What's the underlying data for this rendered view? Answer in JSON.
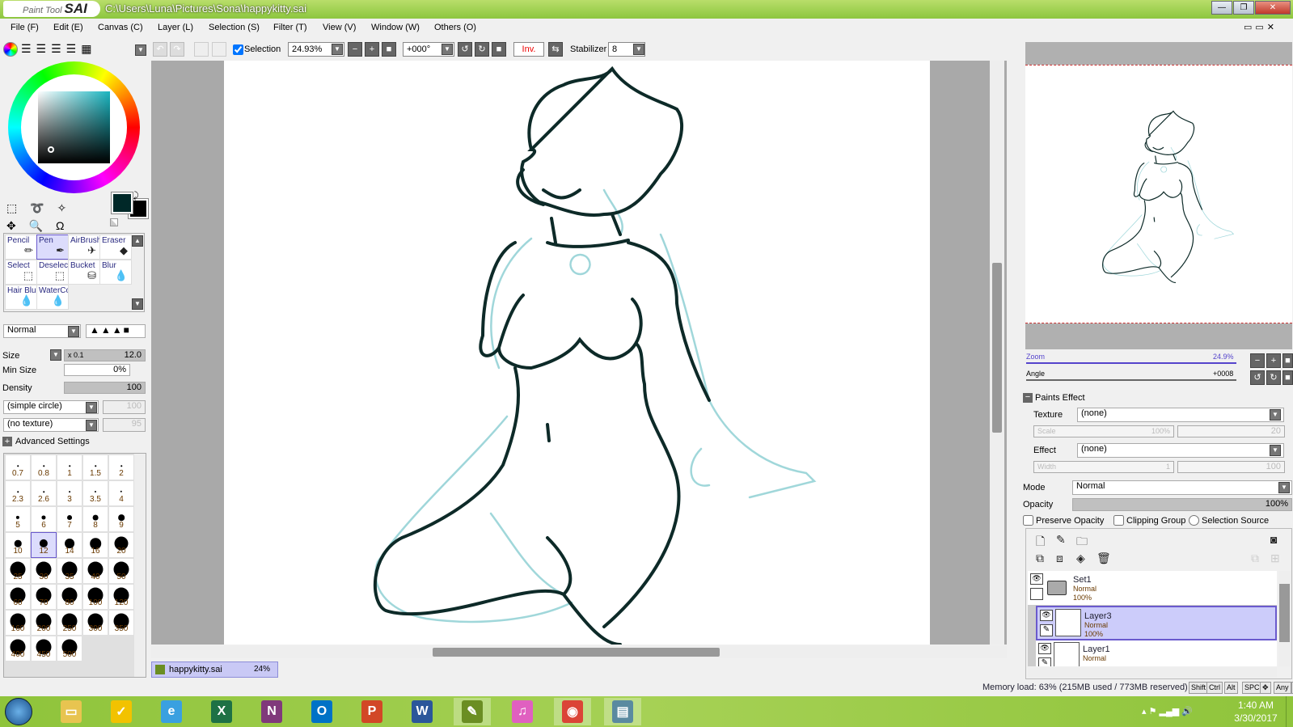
{
  "app": {
    "logo_text": "Paint Tool SAI",
    "title_path": "C:\\Users\\Luna\\Pictures\\Sona\\happykitty.sai"
  },
  "menu": [
    "File (F)",
    "Edit (E)",
    "Canvas (C)",
    "Layer (L)",
    "Selection (S)",
    "Filter (T)",
    "View (V)",
    "Window (W)",
    "Others (O)"
  ],
  "toolbar": {
    "selection_label": "Selection",
    "selection_checked": true,
    "zoom_value": "24.93%",
    "angle_value": "+000°",
    "invert_label": "Inv.",
    "stabilizer_label": "Stabilizer",
    "stabilizer_value": "8"
  },
  "colors": {
    "primary": "#002828",
    "secondary": "#000000",
    "accent": "#6a5acd",
    "titlebar": "#8cc63f",
    "sketch_line": "#0d2a28",
    "sketch_blue": "#8fd0d4"
  },
  "tools": [
    {
      "label": "Pencil",
      "icon": "pencil-icon"
    },
    {
      "label": "Pen",
      "icon": "pen-icon",
      "selected": true
    },
    {
      "label": "AirBrush",
      "icon": "airbrush-icon"
    },
    {
      "label": "Eraser",
      "icon": "eraser-icon"
    },
    {
      "label": "Select",
      "icon": "select-icon"
    },
    {
      "label": "Deselect",
      "icon": "deselect-icon"
    },
    {
      "label": "Bucket",
      "icon": "bucket-icon"
    },
    {
      "label": "Blur",
      "icon": "blur-icon"
    },
    {
      "label": "Hair Blur",
      "icon": "hair-blur-icon"
    },
    {
      "label": "WaterColor",
      "icon": "watercolor-icon"
    }
  ],
  "brush": {
    "blend_mode": "Normal",
    "size_label": "Size",
    "size_multiplier": "x 0.1",
    "size_value": "12.0",
    "min_size_label": "Min Size",
    "min_size_value": "0%",
    "density_label": "Density",
    "density_value": "100",
    "shape": "(simple circle)",
    "shape_value": "100",
    "texture": "(no texture)",
    "texture_value": "95",
    "advanced_label": "Advanced Settings",
    "sizes": [
      "0.7",
      "0.8",
      "1",
      "1.5",
      "2",
      "2.3",
      "2.6",
      "3",
      "3.5",
      "4",
      "5",
      "6",
      "7",
      "8",
      "9",
      "10",
      "12",
      "14",
      "16",
      "20",
      "25",
      "30",
      "35",
      "40",
      "50",
      "60",
      "70",
      "80",
      "100",
      "120",
      "160",
      "200",
      "250",
      "300",
      "350",
      "400",
      "450",
      "500"
    ],
    "selected_size": "12"
  },
  "document_tab": {
    "name": "happykitty.sai",
    "zoom": "24%"
  },
  "navigator": {
    "zoom_label": "Zoom",
    "zoom_value": "24.9%",
    "angle_label": "Angle",
    "angle_value": "+0008"
  },
  "paints_effect": {
    "header": "Paints Effect",
    "texture_label": "Texture",
    "texture_value": "(none)",
    "scale_label": "Scale",
    "scale_value": "100%",
    "scale_value2": "20",
    "effect_label": "Effect",
    "effect_value": "(none)",
    "width_label": "Width",
    "width_value": "1",
    "width_value2": "100"
  },
  "layer_props": {
    "mode_label": "Mode",
    "mode_value": "Normal",
    "opacity_label": "Opacity",
    "opacity_value": "100%",
    "preserve_opacity": "Preserve Opacity",
    "clipping_group": "Clipping Group",
    "selection_source": "Selection Source"
  },
  "layers": [
    {
      "name": "Set1",
      "mode": "Normal",
      "opacity": "100%",
      "type": "folder"
    },
    {
      "name": "Layer3",
      "mode": "Normal",
      "opacity": "100%",
      "type": "layer",
      "selected": true
    },
    {
      "name": "Layer1",
      "mode": "Normal",
      "opacity": "",
      "type": "layer"
    }
  ],
  "status": {
    "memory": "Memory load: 63% (215MB used / 773MB reserved)",
    "keys": [
      "Shift",
      "Ctrl",
      "Alt",
      "SPC",
      "✥",
      "Any",
      "✎"
    ]
  },
  "taskbar": {
    "apps": [
      {
        "name": "explorer",
        "color": "#e8c450",
        "glyph": "▭"
      },
      {
        "name": "norton",
        "color": "#f2c200",
        "glyph": "✓"
      },
      {
        "name": "internet-explorer",
        "color": "#3aa0e0",
        "glyph": "e"
      },
      {
        "name": "excel",
        "color": "#1e7145",
        "glyph": "X"
      },
      {
        "name": "onenote",
        "color": "#80397b",
        "glyph": "N"
      },
      {
        "name": "outlook",
        "color": "#0072c6",
        "glyph": "O"
      },
      {
        "name": "powerpoint",
        "color": "#d24726",
        "glyph": "P"
      },
      {
        "name": "word",
        "color": "#2b579a",
        "glyph": "W"
      },
      {
        "name": "paint-tool-sai",
        "color": "#6b8e23",
        "glyph": "✎"
      },
      {
        "name": "itunes",
        "color": "#e060c0",
        "glyph": "♫"
      },
      {
        "name": "chrome",
        "color": "#db4437",
        "glyph": "◉"
      },
      {
        "name": "window",
        "color": "#5a8aa0",
        "glyph": "▤"
      }
    ],
    "time": "1:40 AM",
    "date": "3/30/2017"
  }
}
